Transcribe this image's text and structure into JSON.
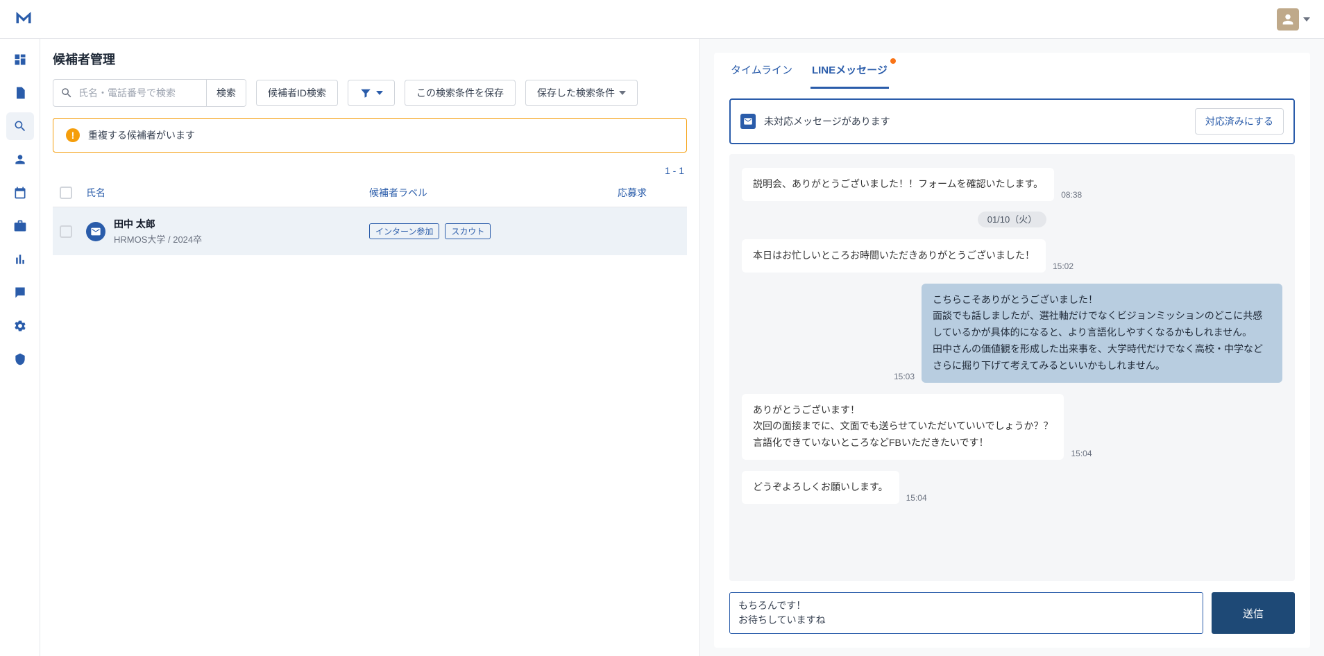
{
  "header": {
    "page_title": "候補者管理"
  },
  "toolbar": {
    "search_placeholder": "氏名・電話番号で検索",
    "search_button": "検索",
    "id_search": "候補者ID検索",
    "save_condition": "この検索条件を保存",
    "saved_conditions": "保存した検索条件"
  },
  "warning": {
    "text": "重複する候補者がいます"
  },
  "count": "1 - 1",
  "table": {
    "col_name": "氏名",
    "col_label": "候補者ラベル",
    "col_req": "応募求",
    "row": {
      "name": "田中 太郎",
      "subtitle": "HRMOS大学 / 2024卒",
      "tags": [
        "インターン参加",
        "スカウト"
      ]
    }
  },
  "chat": {
    "tabs": {
      "timeline": "タイムライン",
      "line": "LINEメッセージ"
    },
    "alert": {
      "text": "未対応メッセージがあります",
      "button": "対応済みにする"
    },
    "date_divider": "01/10（火）",
    "messages": [
      {
        "side": "left",
        "text": "説明会、ありがとうございました！！フォームを確認いたします。",
        "time": "08:38"
      },
      {
        "side": "left",
        "text": "本日はお忙しいところお時間いただきありがとうございました！",
        "time": "15:02"
      },
      {
        "side": "right",
        "text": "こちらこそありがとうございました！\n面談でも話しましたが、選社軸だけでなくビジョンミッションのどこに共感しているかが具体的になると、より言語化しやすくなるかもしれません。\n田中さんの価値観を形成した出来事を、大学時代だけでなく高校・中学などさらに掘り下げて考えてみるといいかもしれません。",
        "time": "15:03"
      },
      {
        "side": "left",
        "text": "ありがとうございます！\n次回の面接までに、文面でも送らせていただいていいでしょうか？？\n言語化できていないところなどFBいただきたいです！",
        "time": "15:04"
      },
      {
        "side": "left",
        "text": "どうぞよろしくお願いします。",
        "time": "15:04"
      }
    ],
    "compose_value": "もちろんです！\nお待ちしていますね",
    "send_label": "送信"
  }
}
